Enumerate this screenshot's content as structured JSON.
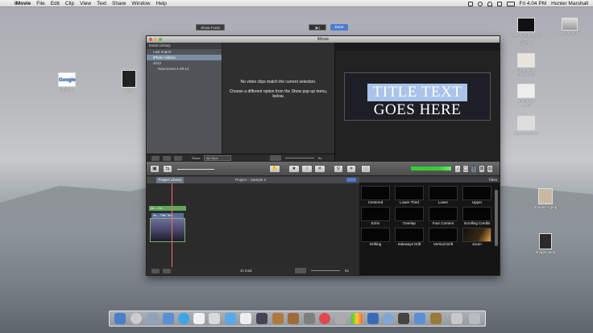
{
  "menubar": {
    "app_name": "iMovie",
    "menus": [
      "File",
      "Edit",
      "Clip",
      "View",
      "Text",
      "Share",
      "Window",
      "Help"
    ],
    "clock": "Fri 4:04 PM",
    "user": "Hunter Marshall"
  },
  "desktop_icons": [
    {
      "label": "logo.png"
    },
    {
      "label": "Copy"
    },
    {
      "label": "Getting to the shop 1...",
      "label2": "(3).mov"
    },
    {
      "label": "Macintosh HD"
    },
    {
      "label": "Screenflow",
      "label2": "movie.mov"
    },
    {
      "label": "Doctor Lab",
      "label2": "...stuff"
    },
    {
      "label": "Screenflow.mov"
    },
    {
      "label": "Images-1.jpeg"
    },
    {
      "label": "images.jpeg"
    }
  ],
  "window": {
    "title": "iMovie",
    "event_library": {
      "header": "Event Library",
      "items": [
        "Last Import",
        "iPhoto Videos",
        "2012",
        "New Event 4-29-12"
      ]
    },
    "browser_message_1": "No video clips match the current selection.",
    "browser_message_2": "Choose a different option from the Show pop-up menu, below.",
    "show_label": "Show:",
    "show_value": "All Clips",
    "zoom_label": "5s",
    "viewer": {
      "show_fonts": "Show Fonts",
      "play": "|▶|",
      "done": "Done",
      "title_line1": "TITLE TEXT",
      "title_line2": "GOES HERE"
    },
    "project": {
      "tab": "Project Library",
      "title": "Project – Sample 2",
      "clip_label1": "4s – Ce...",
      "clip_label2": "4s – Title Text",
      "total": "4s total",
      "zoom": "5s"
    },
    "titles": {
      "header": "Titles",
      "items": [
        "Centered",
        "Lower Third",
        "Lower",
        "Upper",
        "Echo",
        "Overlap",
        "Four Corners",
        "Scrolling Credits",
        "Drifting",
        "Sideways Drift",
        "Vertical Drift",
        "Zoom"
      ]
    }
  },
  "colors": {
    "accent": "#4f7ad0",
    "selected_text_bg": "#a9c3ea",
    "playhead": "#ff6b5a"
  }
}
